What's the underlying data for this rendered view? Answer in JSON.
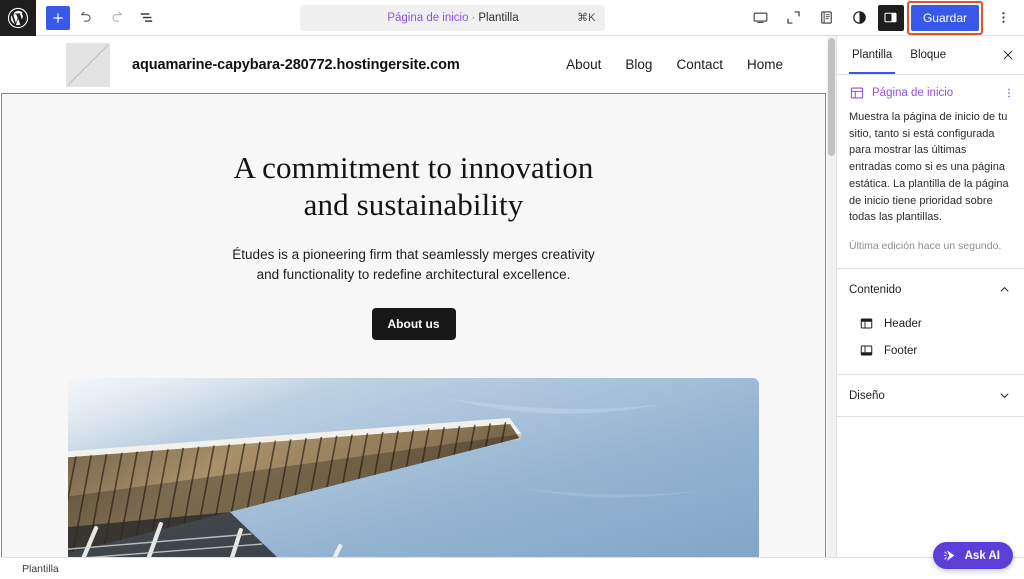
{
  "toolbar": {
    "wp_logo_name": "WordPress",
    "add_label": "+",
    "undo_title": "Deshacer",
    "redo_title": "Rehacer",
    "listview_title": "Vista de lista",
    "command_center": {
      "accent_text": "Página de inicio",
      "separator": "·",
      "suffix_text": "Plantilla",
      "shortcut": "⌘K"
    },
    "view_title": "Ver",
    "zoomout_title": "Zoom",
    "styles_title": "Estilos",
    "contrast_title": "Estilos",
    "sidebar_toggle_title": "Ajustes",
    "save_label": "Guardar",
    "options_title": "Opciones",
    "highlight_color": "#ea4f2e",
    "accent_color": "#3858e9"
  },
  "canvas": {
    "site_header": {
      "logo_alt": "Logotipo del sitio",
      "site_title": "aquamarine-capybara-280772.hostingersite.com",
      "nav": [
        {
          "label": "About"
        },
        {
          "label": "Blog"
        },
        {
          "label": "Contact"
        },
        {
          "label": "Home"
        }
      ]
    },
    "hero": {
      "heading": "A commitment to innovation and sustainability",
      "paragraph": "Études is a pioneering firm that seamlessly merges creativity and functionality to redefine architectural excellence.",
      "cta_label": "About us",
      "image_alt": "Edificio arquitectónico con techo de lamas de madera contra el cielo azul"
    },
    "selection_border_color": "#4f94d4"
  },
  "sidebar": {
    "tabs": [
      {
        "label": "Plantilla",
        "active": true
      },
      {
        "label": "Bloque",
        "active": false
      }
    ],
    "close_title": "Cerrar ajustes",
    "template": {
      "icon_name": "template-icon",
      "title": "Página de inicio",
      "title_color": "#8c52e5",
      "description": "Muestra la página de inicio de tu sitio, tanto si está configurada para mostrar las últimas entradas como si es una página estática. La plantilla de la página de inicio tiene prioridad sobre todas las plantillas.",
      "last_edited": "Última edición hace un segundo.",
      "kebab_title": "Acciones"
    },
    "sections": [
      {
        "label": "Contenido",
        "expanded": true,
        "items": [
          {
            "label": "Header",
            "icon": "header-icon"
          },
          {
            "label": "Footer",
            "icon": "footer-icon"
          }
        ]
      },
      {
        "label": "Diseño",
        "expanded": false,
        "items": []
      }
    ]
  },
  "bottom_bar": {
    "label": "Plantilla"
  },
  "ask_ai": {
    "label": "Ask AI",
    "icon_name": "sparkle-arrow-icon",
    "color": "#5b3fd6"
  }
}
